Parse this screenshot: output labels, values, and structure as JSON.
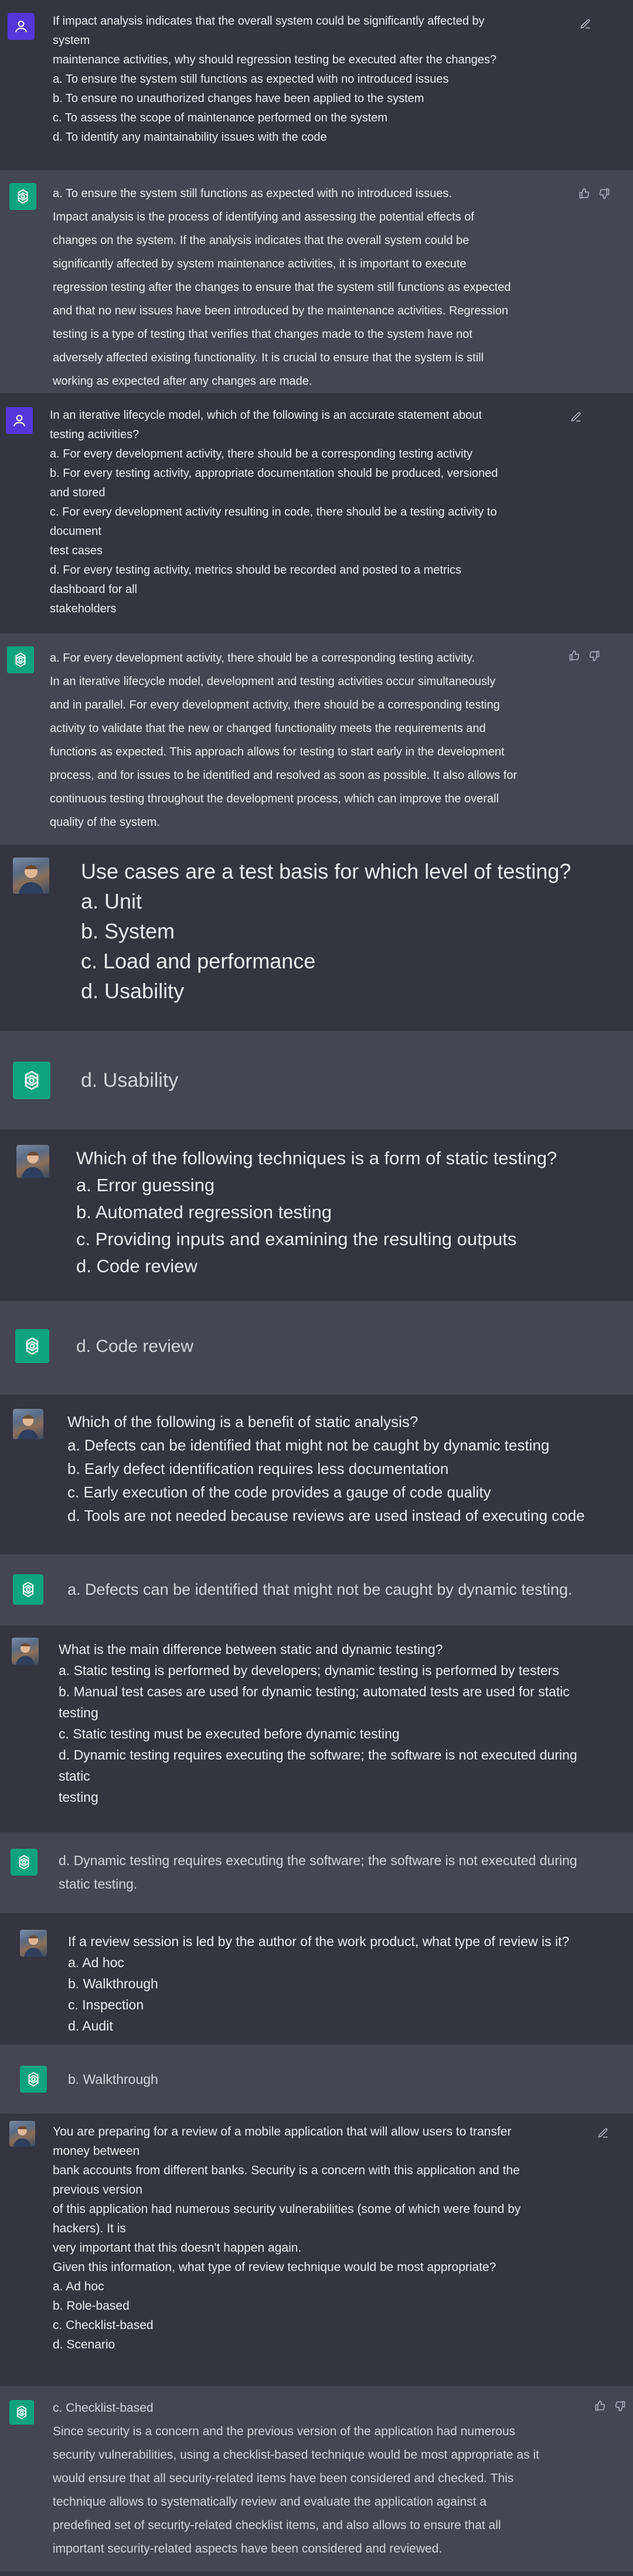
{
  "messages": [
    {
      "role": "user",
      "lines": [
        "If impact analysis indicates that the overall system could be significantly affected by",
        "system",
        "maintenance activities, why should regression testing be executed after the changes?",
        "a. To ensure the system still functions as expected with no introduced issues",
        "b. To ensure no unauthorized changes have been applied to the system",
        "c. To assess the scope of maintenance performed on the system",
        "d. To identify any maintainability issues with the code"
      ]
    },
    {
      "role": "assistant",
      "lines": [
        "a. To ensure the system still functions as expected with no introduced issues.",
        "Impact analysis is the process of identifying and assessing the potential effects of",
        "changes on the system. If the analysis indicates that the overall system could be",
        "significantly affected by system maintenance activities, it is important to execute",
        "regression testing after the changes to ensure that the system still functions as expected",
        "and that no new issues have been introduced by the maintenance activities. Regression",
        "testing is a type of testing that verifies that changes made to the system have not",
        "adversely affected existing functionality. It is crucial to ensure that the system is still",
        "working as expected after any changes are made."
      ]
    },
    {
      "role": "user",
      "lines": [
        "In an iterative lifecycle model, which of the following is an accurate statement about",
        "testing activities?",
        "a. For every development activity, there should be a corresponding testing activity",
        "b. For every testing activity, appropriate documentation should be produced, versioned",
        "and stored",
        "c. For every development activity resulting in code, there should be a testing activity to",
        "document",
        "test cases",
        "d. For every testing activity, metrics should be recorded and posted to a metrics",
        "dashboard for all",
        "stakeholders"
      ]
    },
    {
      "role": "assistant",
      "lines": [
        "a. For every development activity, there should be a corresponding testing activity.",
        "In an iterative lifecycle model, development and testing activities occur simultaneously",
        "and in parallel. For every development activity, there should be a corresponding testing",
        "activity to validate that the new or changed functionality meets the requirements and",
        "functions as expected. This approach allows for testing to start early in the development",
        "process, and for issues to be identified and resolved as soon as possible. It also allows for",
        "continuous testing throughout the development process, which can improve the overall",
        "quality of the system."
      ]
    },
    {
      "role": "user",
      "lines": [
        "Use cases are a test basis for which level of testing?",
        "a. Unit",
        "b. System",
        "c. Load and performance",
        "d. Usability"
      ]
    },
    {
      "role": "assistant",
      "lines": [
        "d. Usability"
      ]
    },
    {
      "role": "user",
      "lines": [
        "Which of the following techniques is a form of static testing?",
        "a. Error guessing",
        "b. Automated regression testing",
        "c. Providing inputs and examining the resulting outputs",
        "d. Code review"
      ]
    },
    {
      "role": "assistant",
      "lines": [
        "d. Code review"
      ]
    },
    {
      "role": "user",
      "lines": [
        "Which of the following is a benefit of static analysis?",
        "a. Defects can be identified that might not be caught by dynamic testing",
        "b. Early defect identification requires less documentation",
        "c. Early execution of the code provides a gauge of code quality",
        "d. Tools are not needed because reviews are used instead of executing code"
      ]
    },
    {
      "role": "assistant",
      "lines": [
        "a. Defects can be identified that might not be caught by dynamic testing."
      ]
    },
    {
      "role": "user",
      "lines": [
        "What is the main difference between static and dynamic testing?",
        "a. Static testing is performed by developers; dynamic testing is performed by testers",
        "b. Manual test cases are used for dynamic testing; automated tests are used for static",
        "testing",
        "c. Static testing must be executed before dynamic testing",
        "d. Dynamic testing requires executing the software; the software is not executed during",
        "static",
        "testing"
      ]
    },
    {
      "role": "assistant",
      "lines": [
        "d. Dynamic testing requires executing the software; the software is not executed during",
        "static testing."
      ]
    },
    {
      "role": "user",
      "lines": [
        "If a review session is led by the author of the work product, what type of review is it?",
        "a. Ad hoc",
        "b. Walkthrough",
        "c. Inspection",
        "d. Audit"
      ]
    },
    {
      "role": "assistant",
      "lines": [
        "b. Walkthrough"
      ]
    },
    {
      "role": "user",
      "lines": [
        "You are preparing for a review of a mobile application that will allow users to transfer",
        "money between",
        "bank accounts from different banks. Security is a concern with this application and the",
        "previous version",
        "of this application had numerous security vulnerabilities (some of which were found by",
        "hackers). It is",
        "very important that this doesn't happen again.",
        "Given this information, what type of review technique would be most appropriate?",
        "a. Ad hoc",
        "b. Role-based",
        "c. Checklist-based",
        "d. Scenario"
      ]
    },
    {
      "role": "assistant",
      "lines": [
        "c. Checklist-based",
        "Since security is a concern and the previous version of the application had numerous",
        "security vulnerabilities, using a checklist-based technique would be most appropriate as it",
        "would ensure that all security-related items have been considered and checked. This",
        "technique allows to systematically review and evaluate the application against a",
        "predefined set of security-related checklist items, and also allows to ensure that all",
        "important security-related aspects have been considered and reviewed."
      ]
    }
  ],
  "colors": {
    "user_bg": "#343541",
    "assistant_bg": "#444654",
    "user_icon": "#5436da",
    "assistant_icon": "#10a37f",
    "text": "#ececf1",
    "muted": "#acacbe"
  },
  "icons": {
    "user_avatar": "person-icon",
    "assistant_avatar": "openai-logo-icon",
    "edit": "edit-icon",
    "thumbs_up": "thumbs-up-icon",
    "thumbs_down": "thumbs-down-icon"
  }
}
